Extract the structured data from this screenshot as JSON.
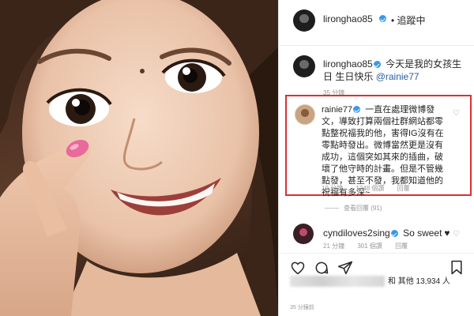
{
  "post": {
    "username": "lironghao85",
    "follow_status": "• 追蹤中",
    "caption_username": "lironghao85",
    "caption_text": "今天是我的女孩生日 生日快乐",
    "caption_mention": "@rainie77",
    "caption_time": "35 分鐘"
  },
  "highlighted_comment": {
    "username": "rainie77",
    "text": "一直在處理微博發文，導致打算兩個社群網站都零點整祝福我的他，害得IG沒有在零點時發出。微博當然更是沒有成功，這個突如其來的插曲，破壞了他守時的計畫。但是不管幾點發，甚至不發，我都知道他的祝福有多深~",
    "time": "19 分鐘",
    "likes": "1248 個讚",
    "reply": "回覆"
  },
  "view_replies_label": "查看回覆 (91)",
  "second_comment": {
    "username": "cyndiloves2sing",
    "text": "So sweet",
    "emoji": "♥",
    "time": "21 分鐘",
    "likes": "301 個讚",
    "reply": "回覆"
  },
  "likes_summary": "和 其他 13,934 人",
  "post_time": "35 分鐘前",
  "icons": [
    "heart-icon",
    "comment-icon",
    "share-icon",
    "bookmark-icon",
    "verified-badge-icon"
  ],
  "colors": {
    "highlight_border": "#d93232",
    "verified": "#3897f0",
    "mention": "#2a5d9c",
    "nail": "#e86a9a"
  }
}
